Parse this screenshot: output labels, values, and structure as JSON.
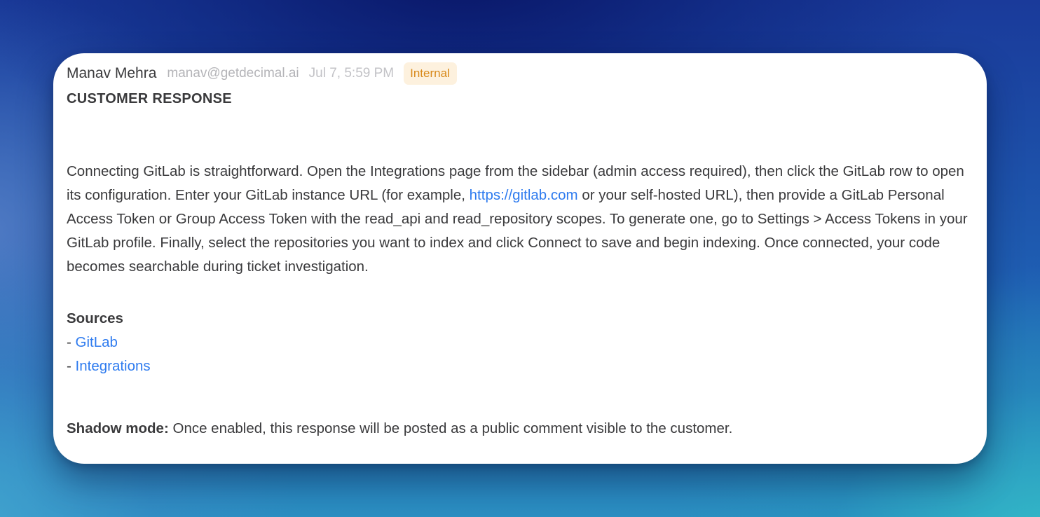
{
  "message": {
    "author": "Manav Mehra",
    "email": "manav@getdecimal.ai",
    "timestamp": "Jul 7, 5:59 PM",
    "badge": "Internal",
    "section_title": "CUSTOMER RESPONSE",
    "body_before_link": "Connecting GitLab is straightforward. Open the Integrations page from the sidebar (admin access required), then click the GitLab row to open its configuration. Enter your GitLab instance URL (for example, ",
    "body_link": "https://gitlab.com",
    "body_after_link": " or your self-hosted URL), then provide a GitLab Personal Access Token or Group Access Token with the read_api and read_repository scopes. To generate one, go to Settings > Access Tokens in your GitLab profile. Finally, select the repositories you want to index and click Connect to save and begin indexing. Once connected, your code becomes searchable during ticket investigation.",
    "sources_title": "Sources",
    "sources": [
      {
        "prefix": "- ",
        "label": "GitLab"
      },
      {
        "prefix": "- ",
        "label": "Integrations"
      }
    ],
    "shadow_label": "Shadow mode:",
    "shadow_text": " Once enabled, this response will be posted as a public comment visible to the customer."
  },
  "colors": {
    "link": "#2e7bef",
    "badge_text": "#d8891a",
    "badge_bg": "#fdf1de",
    "text": "#3a3a3c",
    "muted": "#b4b4b8"
  }
}
